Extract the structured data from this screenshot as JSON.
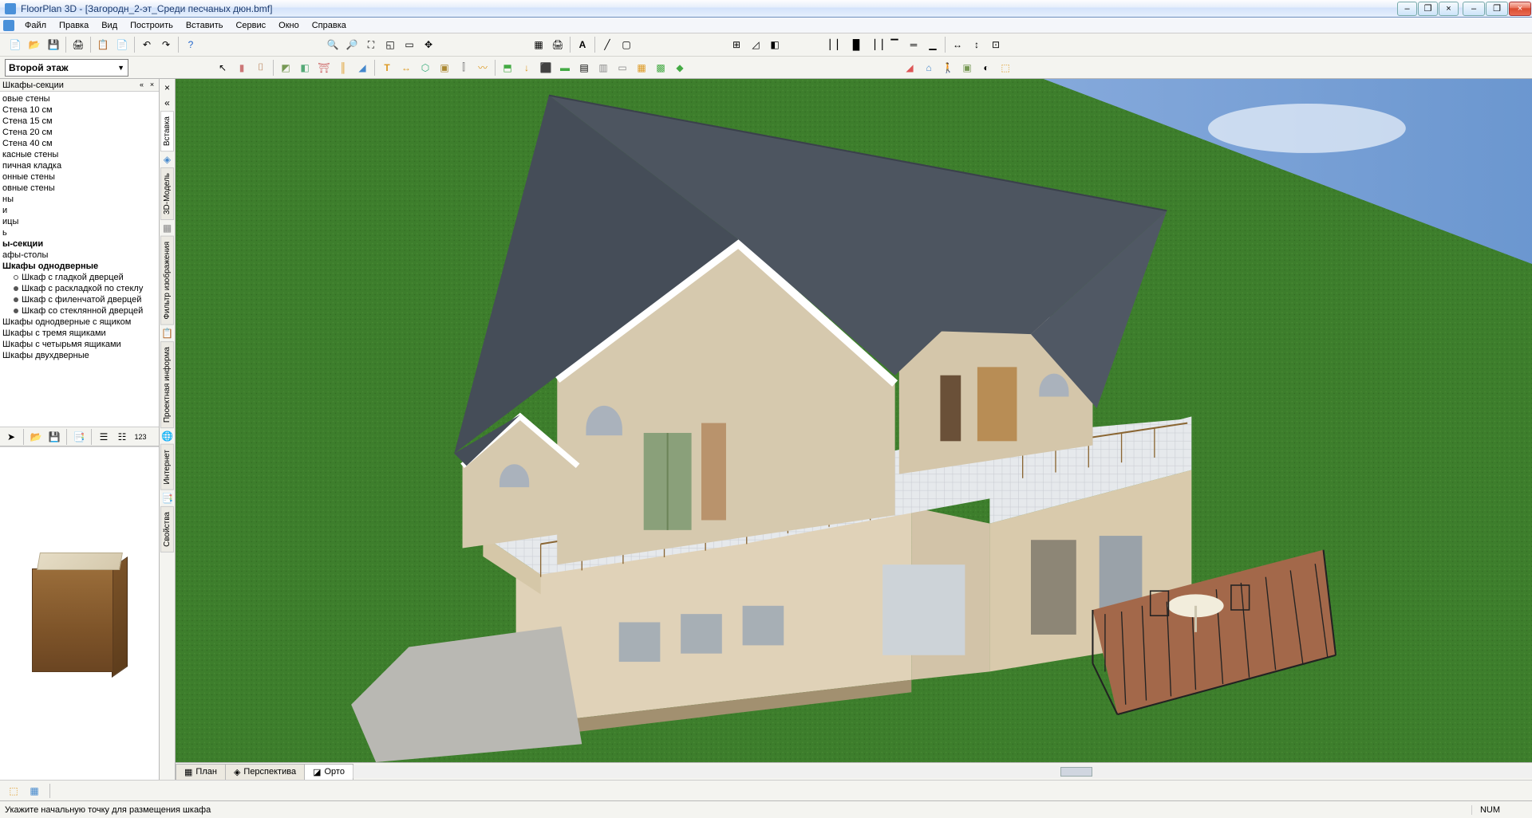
{
  "app": {
    "title": "FloorPlan 3D - [Загородн_2-эт_Среди песчаных дюн.bmf]"
  },
  "menu": [
    "Файл",
    "Правка",
    "Вид",
    "Построить",
    "Вставить",
    "Сервис",
    "Окно",
    "Справка"
  ],
  "floor_selector": {
    "current": "Второй этаж"
  },
  "side_panel": {
    "title": "Шкафы-секции",
    "items": [
      {
        "t": "овые стены"
      },
      {
        "t": "Стена 10 см"
      },
      {
        "t": "Стена 15 см"
      },
      {
        "t": "Стена 20 см"
      },
      {
        "t": "Стена 40 см"
      },
      {
        "t": "касные стены"
      },
      {
        "t": "пичная кладка"
      },
      {
        "t": "онные стены"
      },
      {
        "t": "овные стены"
      },
      {
        "t": "ны"
      },
      {
        "t": "и"
      },
      {
        "t": "ицы"
      },
      {
        "t": "ь"
      },
      {
        "t": "ы-секции",
        "bold": true
      },
      {
        "t": "афы-столы"
      },
      {
        "t": "Шкафы однодверные",
        "bold": true
      },
      {
        "t": "Шкаф с гладкой дверцей",
        "sub": true,
        "hollow": true
      },
      {
        "t": "Шкаф с раскладкой по стеклу",
        "sub": true
      },
      {
        "t": "Шкаф с филенчатой дверцей",
        "sub": true
      },
      {
        "t": "Шкаф со стеклянной дверцей",
        "sub": true
      },
      {
        "t": "Шкафы однодверные с ящиком"
      },
      {
        "t": "Шкафы с тремя ящиками"
      },
      {
        "t": "Шкафы с четырьмя ящиками"
      },
      {
        "t": "Шкафы двухдверные"
      }
    ]
  },
  "vtabs": [
    "Вставка",
    "3D-Модель",
    "Фильтр изображения",
    "Проектная информа",
    "Интернет",
    "Свойства"
  ],
  "bottom_tabs": {
    "plan": "План",
    "perspective": "Перспектива",
    "ortho": "Орто",
    "active": "ortho"
  },
  "status": {
    "hint": "Укажите начальную точку для размещения шкафа",
    "num": "NUM"
  }
}
